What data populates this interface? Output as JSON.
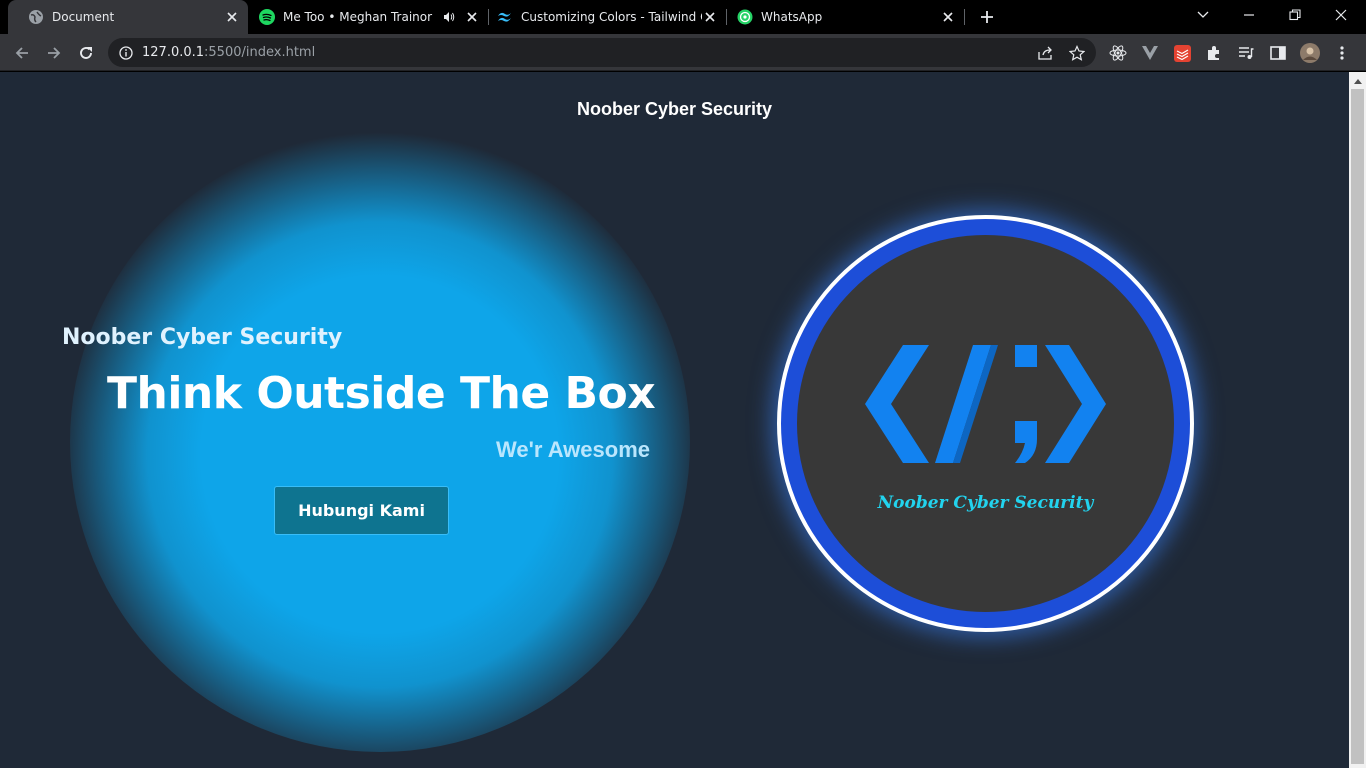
{
  "browser": {
    "tabs": [
      {
        "title": "Document",
        "favicon": "globe-icon",
        "active": true
      },
      {
        "title": "Me Too • Meghan Trainor",
        "favicon": "spotify-icon",
        "audio": true
      },
      {
        "title": "Customizing Colors - Tailwind CSS",
        "favicon": "tailwind-icon"
      },
      {
        "title": "WhatsApp",
        "favicon": "whatsapp-icon"
      }
    ],
    "url_host": "127.0.0.1",
    "url_rest": ":5500/index.html",
    "colors": {
      "tabstrip": "#000000",
      "toolbar": "#35363a",
      "omnibox": "#202124"
    }
  },
  "page": {
    "nav_title": "Noober Cyber Security",
    "hero": {
      "brand": "Noober Cyber Security",
      "headline": "Think Outside The Box",
      "tagline": "We'r Awesome",
      "cta_label": "Hubungi Kami"
    },
    "logo": {
      "caption": "Noober Cyber Security",
      "icon": "code-brackets-logo"
    },
    "colors": {
      "background": "#1f2937",
      "glow": "#0ea5e9",
      "button": "#0e7490",
      "logo_ring": "#1d4ed8",
      "logo_fill": "#383838",
      "logo_text": "#22d3ee"
    }
  }
}
